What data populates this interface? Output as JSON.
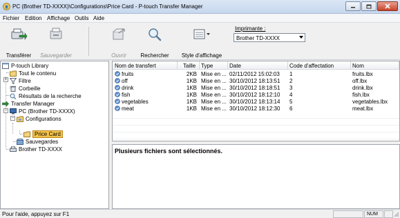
{
  "window": {
    "title": "PC (Brother TD-XXXX)\\Configurations\\Price Card - P-touch Transfer Manager"
  },
  "menu": [
    "Fichier",
    "Edition",
    "Affichage",
    "Outils",
    "Aide"
  ],
  "toolbar": {
    "transfer_label": "Transférer",
    "save_label": "Sauvegarder",
    "open_label": "Ouvrir",
    "search_label": "Rechercher",
    "view_style_label": "Style d'affichage",
    "printer_label": "Imprimante :",
    "printer_value": "Brother TD-XXXX"
  },
  "tree": [
    {
      "label": "P-touch Library",
      "icon": "library-icon"
    },
    {
      "label": "Tout le contenu",
      "icon": "folder-icon"
    },
    {
      "label": "Filtre",
      "icon": "filter-icon"
    },
    {
      "label": "Corbeille",
      "icon": "trash-icon"
    },
    {
      "label": "Résultats de la recherche",
      "icon": "search-results-icon"
    },
    {
      "label": "Transfer Manager",
      "icon": "transfer-manager-icon"
    },
    {
      "label": "PC (Brother TD-XXXX)",
      "icon": "pc-icon"
    },
    {
      "label": "Configurations",
      "icon": "config-folder-icon"
    },
    {
      "label": "Price Card",
      "icon": "folder-icon"
    },
    {
      "label": "Sauvegardes",
      "icon": "backup-icon"
    },
    {
      "label": "Brother TD-XXXX",
      "icon": "printer-icon"
    }
  ],
  "list": {
    "columns": [
      "Nom de transfert",
      "Taille",
      "Type",
      "Date",
      "Code d'affectation",
      "Nom"
    ],
    "rows": [
      [
        "fruits",
        "2KB",
        "Mise en ...",
        "02/11/2012 15:02:03",
        "1",
        "fruits.lbx"
      ],
      [
        "off",
        "1KB",
        "Mise en ...",
        "30/10/2012 18:13:51",
        "2",
        "off.lbx"
      ],
      [
        "drink",
        "1KB",
        "Mise en ...",
        "30/10/2012 18:18:51",
        "3",
        "drink.lbx"
      ],
      [
        "fish",
        "1KB",
        "Mise en ...",
        "30/10/2012 18:12:10",
        "4",
        "fish.lbx"
      ],
      [
        "vegetables",
        "1KB",
        "Mise en ...",
        "30/10/2012 18:13:14",
        "5",
        "vegetables.lbx"
      ],
      [
        "meat",
        "1KB",
        "Mise en ...",
        "30/10/2012 18:12:30",
        "6",
        "meat.lbx"
      ]
    ]
  },
  "preview": {
    "message": "Plusieurs fichiers sont sélectionnés."
  },
  "status": {
    "help_text": "Pour l'aide, appuyez sur F1",
    "num_indicator": "NUM"
  },
  "colors": {
    "selection": "#f5c34a",
    "title_bar": "#c6d7ee",
    "close_button": "#c7452c"
  }
}
